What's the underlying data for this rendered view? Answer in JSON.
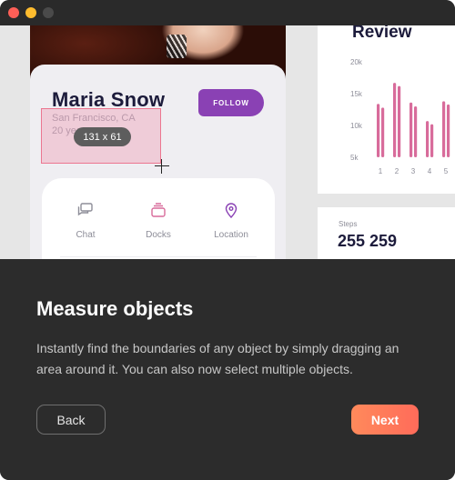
{
  "window": {
    "traffic_lights": {
      "close": "#fe5f57",
      "minimize": "#febc2e",
      "maximize": "#4a4a4a"
    }
  },
  "preview": {
    "profile": {
      "name": "Maria Snow",
      "location": "San Francisco, CA",
      "age": "20 years",
      "follow_label": "FOLLOW"
    },
    "measure": {
      "tooltip": "131 x 61"
    },
    "actions": [
      {
        "label": "Chat",
        "icon": "chat-icon"
      },
      {
        "label": "Docks",
        "icon": "docks-icon"
      },
      {
        "label": "Location",
        "icon": "location-pin-icon"
      }
    ],
    "review": {
      "title": "Review"
    },
    "steps": {
      "label": "Steps",
      "value": "255 259"
    }
  },
  "chart_data": {
    "type": "bar",
    "title": "Review",
    "categories": [
      "1",
      "2",
      "3",
      "4",
      "5"
    ],
    "series": [
      {
        "values": [
          13400,
          16700,
          13600,
          10700,
          13800
        ]
      },
      {
        "values": [
          12800,
          16200,
          13000,
          10200,
          13300
        ]
      }
    ],
    "yticks": [
      "20k",
      "15k",
      "10k",
      "5k"
    ],
    "ylim": [
      5000,
      20000
    ],
    "color": "#d86c9b"
  },
  "onboarding": {
    "heading": "Measure objects",
    "body": "Instantly find the boundaries of any object by simply dragging an area around it. You can also now select multiple objects.",
    "back_label": "Back",
    "next_label": "Next"
  },
  "colors": {
    "accent_purple": "#8a41b4",
    "next_gradient_start": "#ff8a5b",
    "next_gradient_end": "#ff6b5a",
    "dark_bg": "#2c2c2c"
  }
}
